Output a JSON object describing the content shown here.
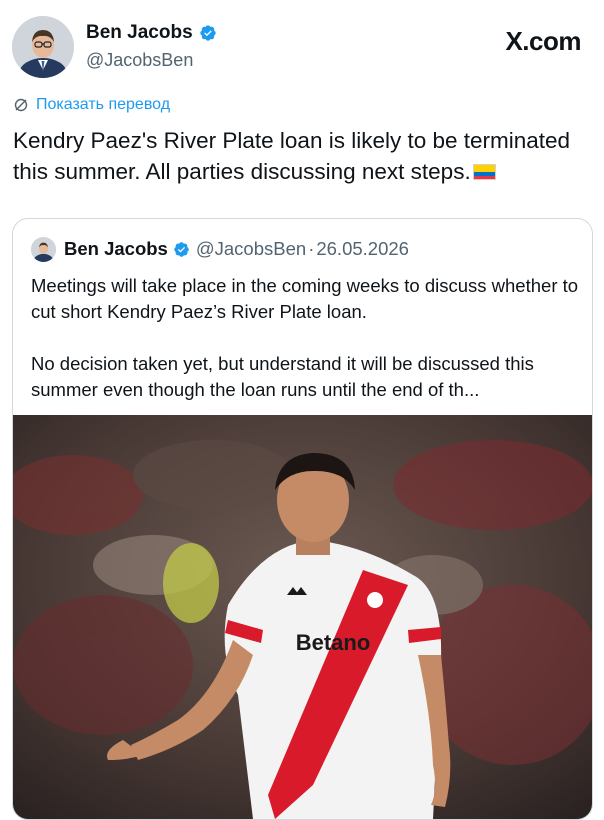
{
  "author": {
    "name": "Ben Jacobs",
    "handle": "@JacobsBen"
  },
  "brand": "X.com",
  "translate_label": "Показать перевод",
  "tweet_text": "Kendry Paez's River Plate loan is likely to be terminated this summer. All parties discussing next steps.",
  "quoted": {
    "name": "Ben Jacobs",
    "handle": "@JacobsBen",
    "separator": "·",
    "date": "26.05.2026",
    "paragraph1": "Meetings will take place in the coming weeks to discuss whether to cut short Kendry Paez’s River Plate loan.",
    "paragraph2": "No decision taken yet, but understand it will be discussed this summer even though the loan runs until the end of th...",
    "photo": {
      "jersey_sponsor": "Betano",
      "kit_brand": "adidas"
    }
  },
  "colors": {
    "accent": "#1d9bf0",
    "secondary_text": "#536471",
    "border": "#cfd9de",
    "jersey_band": "#d91a2a"
  },
  "icons": {
    "verified": "verified-badge-icon",
    "translate": "translate-globe-icon",
    "flag": "ecuador-flag-icon"
  }
}
